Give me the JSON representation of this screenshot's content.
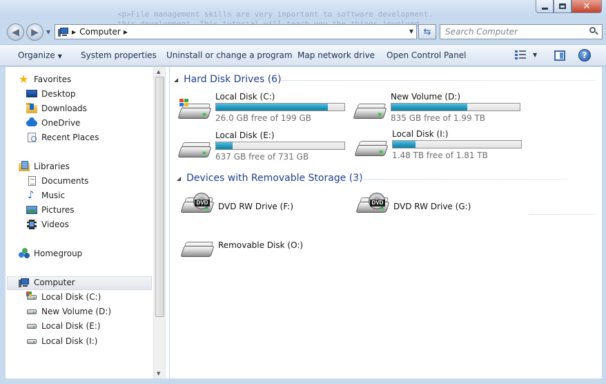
{
  "window": {
    "background_code_line1": "<p>File management skills are very important to software development.",
    "background_code_line2": "this development. This tutorial will teach you the things involved"
  },
  "nav": {
    "address": "Computer",
    "search_placeholder": "Search Computer"
  },
  "commands": {
    "organize": "Organize",
    "system_properties": "System properties",
    "uninstall": "Uninstall or change a program",
    "map_drive": "Map network drive",
    "control_panel": "Open Control Panel"
  },
  "sidebar": {
    "favorites": "Favorites",
    "desktop": "Desktop",
    "downloads": "Downloads",
    "onedrive": "OneDrive",
    "recent_places": "Recent Places",
    "libraries": "Libraries",
    "documents": "Documents",
    "music": "Music",
    "pictures": "Pictures",
    "videos": "Videos",
    "homegroup": "Homegroup",
    "computer": "Computer",
    "drive_c": "Local Disk (C:)",
    "drive_d": "New Volume (D:)",
    "drive_e": "Local Disk (E:)",
    "drive_i": "Local Disk (I:)"
  },
  "groups": {
    "hard_disks": "Hard Disk Drives (6)",
    "removable": "Devices with Removable Storage (3)"
  },
  "drives": [
    {
      "name": "Local Disk (C:)",
      "free": "26.0 GB free of 199 GB",
      "used_fraction": 0.87
    },
    {
      "name": "New Volume (D:)",
      "free": "835 GB free of 1.99 TB",
      "used_fraction": 0.59
    },
    {
      "name": "Local Disk (E:)",
      "free": "637 GB free of 731 GB",
      "used_fraction": 0.13
    },
    {
      "name": "Local Disk (I:)",
      "free": "1.48 TB free of 1.81 TB",
      "used_fraction": 0.18
    }
  ],
  "removable": {
    "dvd_f": "DVD RW Drive (F:)",
    "dvd_g": "DVD RW Drive (G:)",
    "removable_o": "Removable Disk (O:)",
    "dvd_badge": "DVD"
  }
}
